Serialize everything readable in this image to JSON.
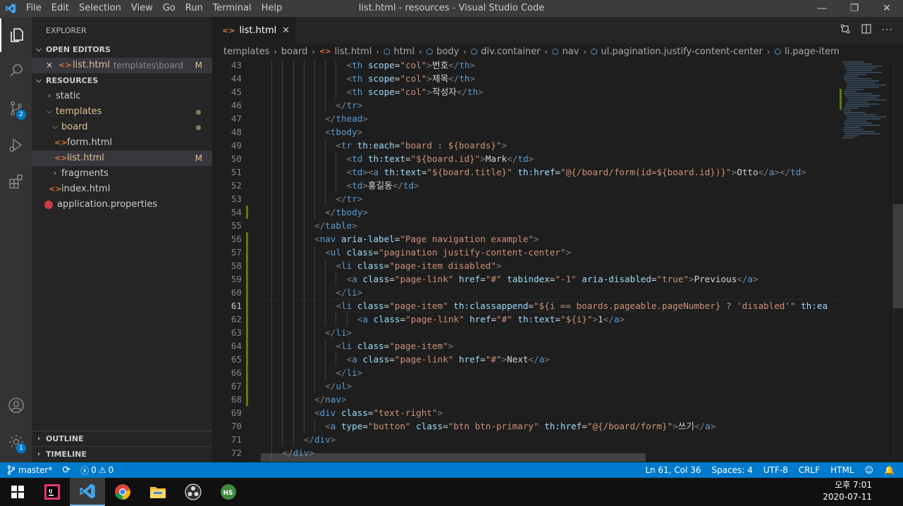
{
  "app": {
    "title": "list.html - resources - Visual Studio Code"
  },
  "menu": [
    "File",
    "Edit",
    "Selection",
    "View",
    "Go",
    "Run",
    "Terminal",
    "Help"
  ],
  "activity": {
    "scm_badge": "2",
    "settings_badge": "1"
  },
  "sidebar": {
    "title": "EXPLORER",
    "open_editors": {
      "label": "OPEN EDITORS",
      "file": "list.html",
      "path": "templates\\board",
      "status": "M"
    },
    "resources_label": "RESOURCES",
    "tree": {
      "static": "static",
      "templates": "templates",
      "board": "board",
      "form": "form.html",
      "list": "list.html",
      "list_status": "M",
      "fragments": "fragments",
      "index": "index.html",
      "app_props": "application.properties"
    },
    "outline": "OUTLINE",
    "timeline": "TIMELINE"
  },
  "tab": {
    "label": "list.html",
    "close": "✕"
  },
  "breadcrumbs": [
    "templates",
    "board",
    "list.html",
    "html",
    "body",
    "div.container",
    "nav",
    "ul.pagination.justify-content-center",
    "li.page-item"
  ],
  "editor": {
    "current_line": 61,
    "lines": [
      {
        "n": 43,
        "indent": 16,
        "mod": false,
        "tokens": [
          [
            "b",
            "<"
          ],
          [
            "t",
            "th"
          ],
          [
            "x",
            " "
          ],
          [
            "a",
            "scope"
          ],
          [
            "x",
            "="
          ],
          [
            "s",
            "\"col\""
          ],
          [
            "b",
            ">"
          ],
          [
            "x",
            "번호"
          ],
          [
            "b",
            "</"
          ],
          [
            "t",
            "th"
          ],
          [
            "b",
            ">"
          ]
        ]
      },
      {
        "n": 44,
        "indent": 16,
        "mod": false,
        "tokens": [
          [
            "b",
            "<"
          ],
          [
            "t",
            "th"
          ],
          [
            "x",
            " "
          ],
          [
            "a",
            "scope"
          ],
          [
            "x",
            "="
          ],
          [
            "s",
            "\"col\""
          ],
          [
            "b",
            ">"
          ],
          [
            "x",
            "제목"
          ],
          [
            "b",
            "</"
          ],
          [
            "t",
            "th"
          ],
          [
            "b",
            ">"
          ]
        ]
      },
      {
        "n": 45,
        "indent": 16,
        "mod": false,
        "tokens": [
          [
            "b",
            "<"
          ],
          [
            "t",
            "th"
          ],
          [
            "x",
            " "
          ],
          [
            "a",
            "scope"
          ],
          [
            "x",
            "="
          ],
          [
            "s",
            "\"col\""
          ],
          [
            "b",
            ">"
          ],
          [
            "x",
            "작성자"
          ],
          [
            "b",
            "</"
          ],
          [
            "t",
            "th"
          ],
          [
            "b",
            ">"
          ]
        ]
      },
      {
        "n": 46,
        "indent": 14,
        "mod": false,
        "tokens": [
          [
            "b",
            "</"
          ],
          [
            "t",
            "tr"
          ],
          [
            "b",
            ">"
          ]
        ]
      },
      {
        "n": 47,
        "indent": 12,
        "mod": false,
        "tokens": [
          [
            "b",
            "</"
          ],
          [
            "t",
            "thead"
          ],
          [
            "b",
            ">"
          ]
        ]
      },
      {
        "n": 48,
        "indent": 12,
        "mod": false,
        "tokens": [
          [
            "b",
            "<"
          ],
          [
            "t",
            "tbody"
          ],
          [
            "b",
            ">"
          ]
        ]
      },
      {
        "n": 49,
        "indent": 14,
        "mod": false,
        "tokens": [
          [
            "b",
            "<"
          ],
          [
            "t",
            "tr"
          ],
          [
            "x",
            " "
          ],
          [
            "a",
            "th:each"
          ],
          [
            "x",
            "="
          ],
          [
            "s",
            "\"board : ${boards}\""
          ],
          [
            "b",
            ">"
          ]
        ]
      },
      {
        "n": 50,
        "indent": 16,
        "mod": false,
        "tokens": [
          [
            "b",
            "<"
          ],
          [
            "t",
            "td"
          ],
          [
            "x",
            " "
          ],
          [
            "a",
            "th:text"
          ],
          [
            "x",
            "="
          ],
          [
            "s",
            "\"${board.id}\""
          ],
          [
            "b",
            ">"
          ],
          [
            "x",
            "Mark"
          ],
          [
            "b",
            "</"
          ],
          [
            "t",
            "td"
          ],
          [
            "b",
            ">"
          ]
        ]
      },
      {
        "n": 51,
        "indent": 16,
        "mod": false,
        "tokens": [
          [
            "b",
            "<"
          ],
          [
            "t",
            "td"
          ],
          [
            "b",
            ">"
          ],
          [
            "b",
            "<"
          ],
          [
            "t",
            "a"
          ],
          [
            "x",
            " "
          ],
          [
            "a",
            "th:text"
          ],
          [
            "x",
            "="
          ],
          [
            "s",
            "\"${board.title}\""
          ],
          [
            "x",
            " "
          ],
          [
            "a",
            "th:href"
          ],
          [
            "x",
            "="
          ],
          [
            "s",
            "\"@{/board/form(id=${board.id})}\""
          ],
          [
            "b",
            ">"
          ],
          [
            "x",
            "Otto"
          ],
          [
            "b",
            "</"
          ],
          [
            "t",
            "a"
          ],
          [
            "b",
            ">"
          ],
          [
            "b",
            "</"
          ],
          [
            "t",
            "td"
          ],
          [
            "b",
            ">"
          ]
        ]
      },
      {
        "n": 52,
        "indent": 16,
        "mod": false,
        "tokens": [
          [
            "b",
            "<"
          ],
          [
            "t",
            "td"
          ],
          [
            "b",
            ">"
          ],
          [
            "x",
            "홍길동"
          ],
          [
            "b",
            "</"
          ],
          [
            "t",
            "td"
          ],
          [
            "b",
            ">"
          ]
        ]
      },
      {
        "n": 53,
        "indent": 14,
        "mod": false,
        "tokens": [
          [
            "b",
            "</"
          ],
          [
            "t",
            "tr"
          ],
          [
            "b",
            ">"
          ]
        ]
      },
      {
        "n": 54,
        "indent": 12,
        "mod": true,
        "tokens": [
          [
            "b",
            "</"
          ],
          [
            "t",
            "tbody"
          ],
          [
            "b",
            ">"
          ]
        ]
      },
      {
        "n": 55,
        "indent": 10,
        "mod": false,
        "tokens": [
          [
            "b",
            "</"
          ],
          [
            "t",
            "table"
          ],
          [
            "b",
            ">"
          ]
        ]
      },
      {
        "n": 56,
        "indent": 10,
        "mod": true,
        "tokens": [
          [
            "b",
            "<"
          ],
          [
            "t",
            "nav"
          ],
          [
            "x",
            " "
          ],
          [
            "a",
            "aria-label"
          ],
          [
            "x",
            "="
          ],
          [
            "s",
            "\"Page navigation example\""
          ],
          [
            "b",
            ">"
          ]
        ]
      },
      {
        "n": 57,
        "indent": 12,
        "mod": true,
        "tokens": [
          [
            "b",
            "<"
          ],
          [
            "t",
            "ul"
          ],
          [
            "x",
            " "
          ],
          [
            "a",
            "class"
          ],
          [
            "x",
            "="
          ],
          [
            "s",
            "\"pagination justify-content-center\""
          ],
          [
            "b",
            ">"
          ]
        ]
      },
      {
        "n": 58,
        "indent": 14,
        "mod": true,
        "tokens": [
          [
            "b",
            "<"
          ],
          [
            "t",
            "li"
          ],
          [
            "x",
            " "
          ],
          [
            "a",
            "class"
          ],
          [
            "x",
            "="
          ],
          [
            "s",
            "\"page-item disabled\""
          ],
          [
            "b",
            ">"
          ]
        ]
      },
      {
        "n": 59,
        "indent": 16,
        "mod": true,
        "tokens": [
          [
            "b",
            "<"
          ],
          [
            "t",
            "a"
          ],
          [
            "x",
            " "
          ],
          [
            "a",
            "class"
          ],
          [
            "x",
            "="
          ],
          [
            "s",
            "\"page-link\""
          ],
          [
            "x",
            " "
          ],
          [
            "a",
            "href"
          ],
          [
            "x",
            "="
          ],
          [
            "s",
            "\"#\""
          ],
          [
            "x",
            " "
          ],
          [
            "a",
            "tabindex"
          ],
          [
            "x",
            "="
          ],
          [
            "s",
            "\"-1\""
          ],
          [
            "x",
            " "
          ],
          [
            "a",
            "aria-disabled"
          ],
          [
            "x",
            "="
          ],
          [
            "s",
            "\"true\""
          ],
          [
            "b",
            ">"
          ],
          [
            "x",
            "Previous"
          ],
          [
            "b",
            "</"
          ],
          [
            "t",
            "a"
          ],
          [
            "b",
            ">"
          ]
        ]
      },
      {
        "n": 60,
        "indent": 14,
        "mod": true,
        "tokens": [
          [
            "b",
            "</"
          ],
          [
            "t",
            "li"
          ],
          [
            "b",
            ">"
          ]
        ]
      },
      {
        "n": 61,
        "indent": 14,
        "mod": true,
        "tokens": [
          [
            "b",
            "<"
          ],
          [
            "t",
            "li"
          ],
          [
            "x",
            " "
          ],
          [
            "a",
            "class"
          ],
          [
            "x",
            "="
          ],
          [
            "s",
            "\"page-item\""
          ],
          [
            "x",
            " "
          ],
          [
            "a",
            "th:classappend"
          ],
          [
            "x",
            "="
          ],
          [
            "s",
            "\"${i == boards.pageable.pageNumber} ? 'disabled'\""
          ],
          [
            "x",
            " "
          ],
          [
            "a",
            "th:ea"
          ]
        ]
      },
      {
        "n": 62,
        "indent": 18,
        "mod": true,
        "tokens": [
          [
            "b",
            "<"
          ],
          [
            "t",
            "a"
          ],
          [
            "x",
            " "
          ],
          [
            "a",
            "class"
          ],
          [
            "x",
            "="
          ],
          [
            "s",
            "\"page-link\""
          ],
          [
            "x",
            " "
          ],
          [
            "a",
            "href"
          ],
          [
            "x",
            "="
          ],
          [
            "s",
            "\"#\""
          ],
          [
            "x",
            " "
          ],
          [
            "a",
            "th:text"
          ],
          [
            "x",
            "="
          ],
          [
            "s",
            "\"${i}\""
          ],
          [
            "b",
            ">"
          ],
          [
            "x",
            "1"
          ],
          [
            "b",
            "</"
          ],
          [
            "t",
            "a"
          ],
          [
            "b",
            ">"
          ]
        ]
      },
      {
        "n": 63,
        "indent": 12,
        "mod": true,
        "tokens": [
          [
            "b",
            "</"
          ],
          [
            "t",
            "li"
          ],
          [
            "b",
            ">"
          ]
        ]
      },
      {
        "n": 64,
        "indent": 14,
        "mod": true,
        "tokens": [
          [
            "b",
            "<"
          ],
          [
            "t",
            "li"
          ],
          [
            "x",
            " "
          ],
          [
            "a",
            "class"
          ],
          [
            "x",
            "="
          ],
          [
            "s",
            "\"page-item\""
          ],
          [
            "b",
            ">"
          ]
        ]
      },
      {
        "n": 65,
        "indent": 16,
        "mod": true,
        "tokens": [
          [
            "b",
            "<"
          ],
          [
            "t",
            "a"
          ],
          [
            "x",
            " "
          ],
          [
            "a",
            "class"
          ],
          [
            "x",
            "="
          ],
          [
            "s",
            "\"page-link\""
          ],
          [
            "x",
            " "
          ],
          [
            "a",
            "href"
          ],
          [
            "x",
            "="
          ],
          [
            "s",
            "\"#\""
          ],
          [
            "b",
            ">"
          ],
          [
            "x",
            "Next"
          ],
          [
            "b",
            "</"
          ],
          [
            "t",
            "a"
          ],
          [
            "b",
            ">"
          ]
        ]
      },
      {
        "n": 66,
        "indent": 14,
        "mod": true,
        "tokens": [
          [
            "b",
            "</"
          ],
          [
            "t",
            "li"
          ],
          [
            "b",
            ">"
          ]
        ]
      },
      {
        "n": 67,
        "indent": 12,
        "mod": true,
        "tokens": [
          [
            "b",
            "</"
          ],
          [
            "t",
            "ul"
          ],
          [
            "b",
            ">"
          ]
        ]
      },
      {
        "n": 68,
        "indent": 10,
        "mod": true,
        "tokens": [
          [
            "b",
            "</"
          ],
          [
            "t",
            "nav"
          ],
          [
            "b",
            ">"
          ]
        ]
      },
      {
        "n": 69,
        "indent": 10,
        "mod": false,
        "tokens": [
          [
            "b",
            "<"
          ],
          [
            "t",
            "div"
          ],
          [
            "x",
            " "
          ],
          [
            "a",
            "class"
          ],
          [
            "x",
            "="
          ],
          [
            "s",
            "\"text-right\""
          ],
          [
            "b",
            ">"
          ]
        ]
      },
      {
        "n": 70,
        "indent": 12,
        "mod": false,
        "tokens": [
          [
            "b",
            "<"
          ],
          [
            "t",
            "a"
          ],
          [
            "x",
            " "
          ],
          [
            "a",
            "type"
          ],
          [
            "x",
            "="
          ],
          [
            "s",
            "\"button\""
          ],
          [
            "x",
            " "
          ],
          [
            "a",
            "class"
          ],
          [
            "x",
            "="
          ],
          [
            "s",
            "\"btn btn-primary\""
          ],
          [
            "x",
            " "
          ],
          [
            "a",
            "th:href"
          ],
          [
            "x",
            "="
          ],
          [
            "s",
            "\"@{/board/form}\""
          ],
          [
            "b",
            ">"
          ],
          [
            "x",
            "쓰기"
          ],
          [
            "b",
            "</"
          ],
          [
            "t",
            "a"
          ],
          [
            "b",
            ">"
          ]
        ]
      },
      {
        "n": 71,
        "indent": 8,
        "mod": false,
        "tokens": [
          [
            "b",
            "</"
          ],
          [
            "t",
            "div"
          ],
          [
            "b",
            ">"
          ]
        ]
      },
      {
        "n": 72,
        "indent": 4,
        "mod": false,
        "tokens": [
          [
            "b",
            "</"
          ],
          [
            "t",
            "div"
          ],
          [
            "b",
            ">"
          ]
        ]
      }
    ]
  },
  "status": {
    "branch": "master*",
    "errors": "0",
    "warnings": "0",
    "position": "Ln 61, Col 36",
    "spaces": "Spaces: 4",
    "encoding": "UTF-8",
    "eol": "CRLF",
    "language": "HTML"
  },
  "taskbar": {
    "time": "오후 7:01",
    "date": "2020-07-11"
  },
  "colors": {
    "accent": "#007acc",
    "titlebar": "#3c3c3c",
    "sidebar": "#252526",
    "editor": "#1e1e1e"
  }
}
